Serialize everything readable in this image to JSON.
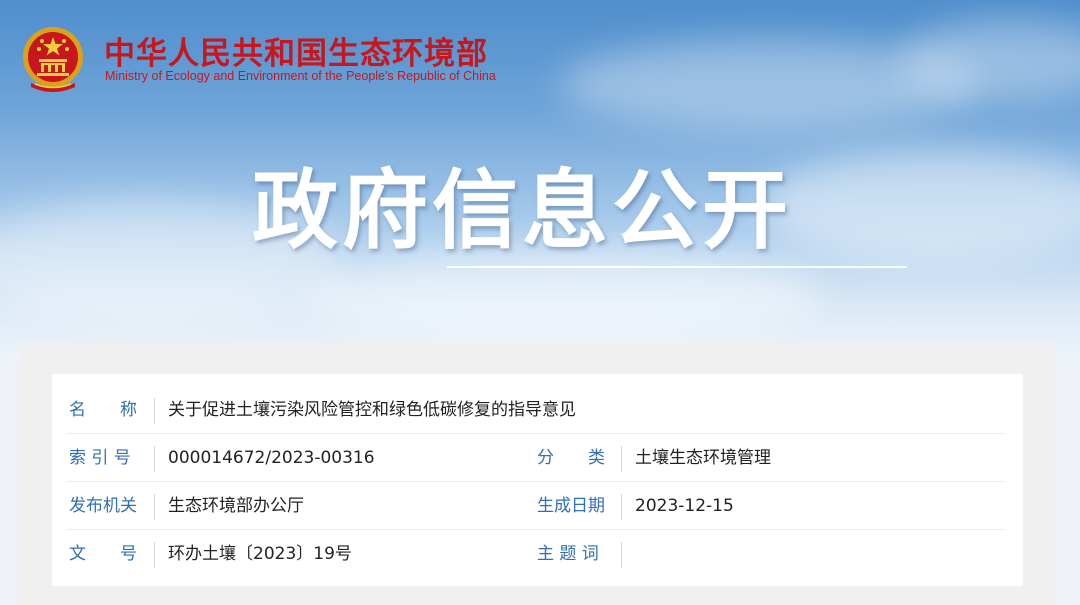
{
  "header": {
    "ministry_cn": "中华人民共和国生态环境部",
    "ministry_en": "Ministry of Ecology and Environment of the People's Republic of China",
    "emblem_icon": "national-emblem-icon",
    "page_title": "政府信息公开"
  },
  "colors": {
    "brand_red": "#c8161d",
    "label_blue": "#2f6fb8",
    "sky_top": "#4f8dcc"
  },
  "doc_info": {
    "name_label": "名　　称",
    "name_value": "关于促进土壤污染风险管控和绿色低碳修复的指导意见",
    "index_label": "索 引 号",
    "index_value": "000014672/2023-00316",
    "category_label": "分　　类",
    "category_value": "土壤生态环境管理",
    "issuer_label": "发布机关",
    "issuer_value": "生态环境部办公厅",
    "date_label": "生成日期",
    "date_value": "2023-12-15",
    "doc_no_label": "文　　号",
    "doc_no_value": "环办土壤〔2023〕19号",
    "keywords_label": "主 题 词",
    "keywords_value": ""
  }
}
